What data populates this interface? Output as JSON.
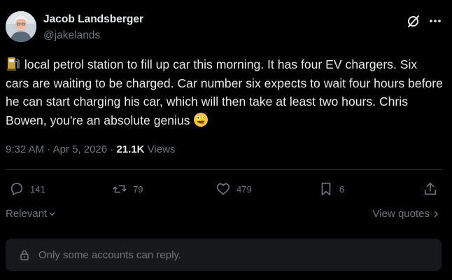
{
  "author": {
    "name": "Jacob Landsberger",
    "handle": "@jakelands"
  },
  "tweet": {
    "text": "local petrol station to fill up car this morning. It has four EV chargers. Six cars are waiting to be charged. Car number six expects to wait four hours before he can start charging his car, which will then take at least two hours. Chris Bowen, you're an absolute genius",
    "leading_emoji": "fuel-pump-emoji",
    "trailing_emoji": "zany-face-emoji"
  },
  "meta": {
    "time": "9:32 AM",
    "separator": " · ",
    "date": "Apr 5, 2026",
    "views_count": "21.1K",
    "views_label": "Views"
  },
  "actions": {
    "replies": "141",
    "reposts": "79",
    "likes": "479",
    "bookmarks": "6"
  },
  "sort": {
    "label": "Relevant"
  },
  "quotes": {
    "label": "View quotes"
  },
  "reply_restriction": {
    "text": "Only some accounts can reply."
  },
  "colors": {
    "background": "#000000",
    "text": "#e7e9ea",
    "muted": "#71767b",
    "divider": "#2f3336",
    "panel": "#16181c"
  }
}
